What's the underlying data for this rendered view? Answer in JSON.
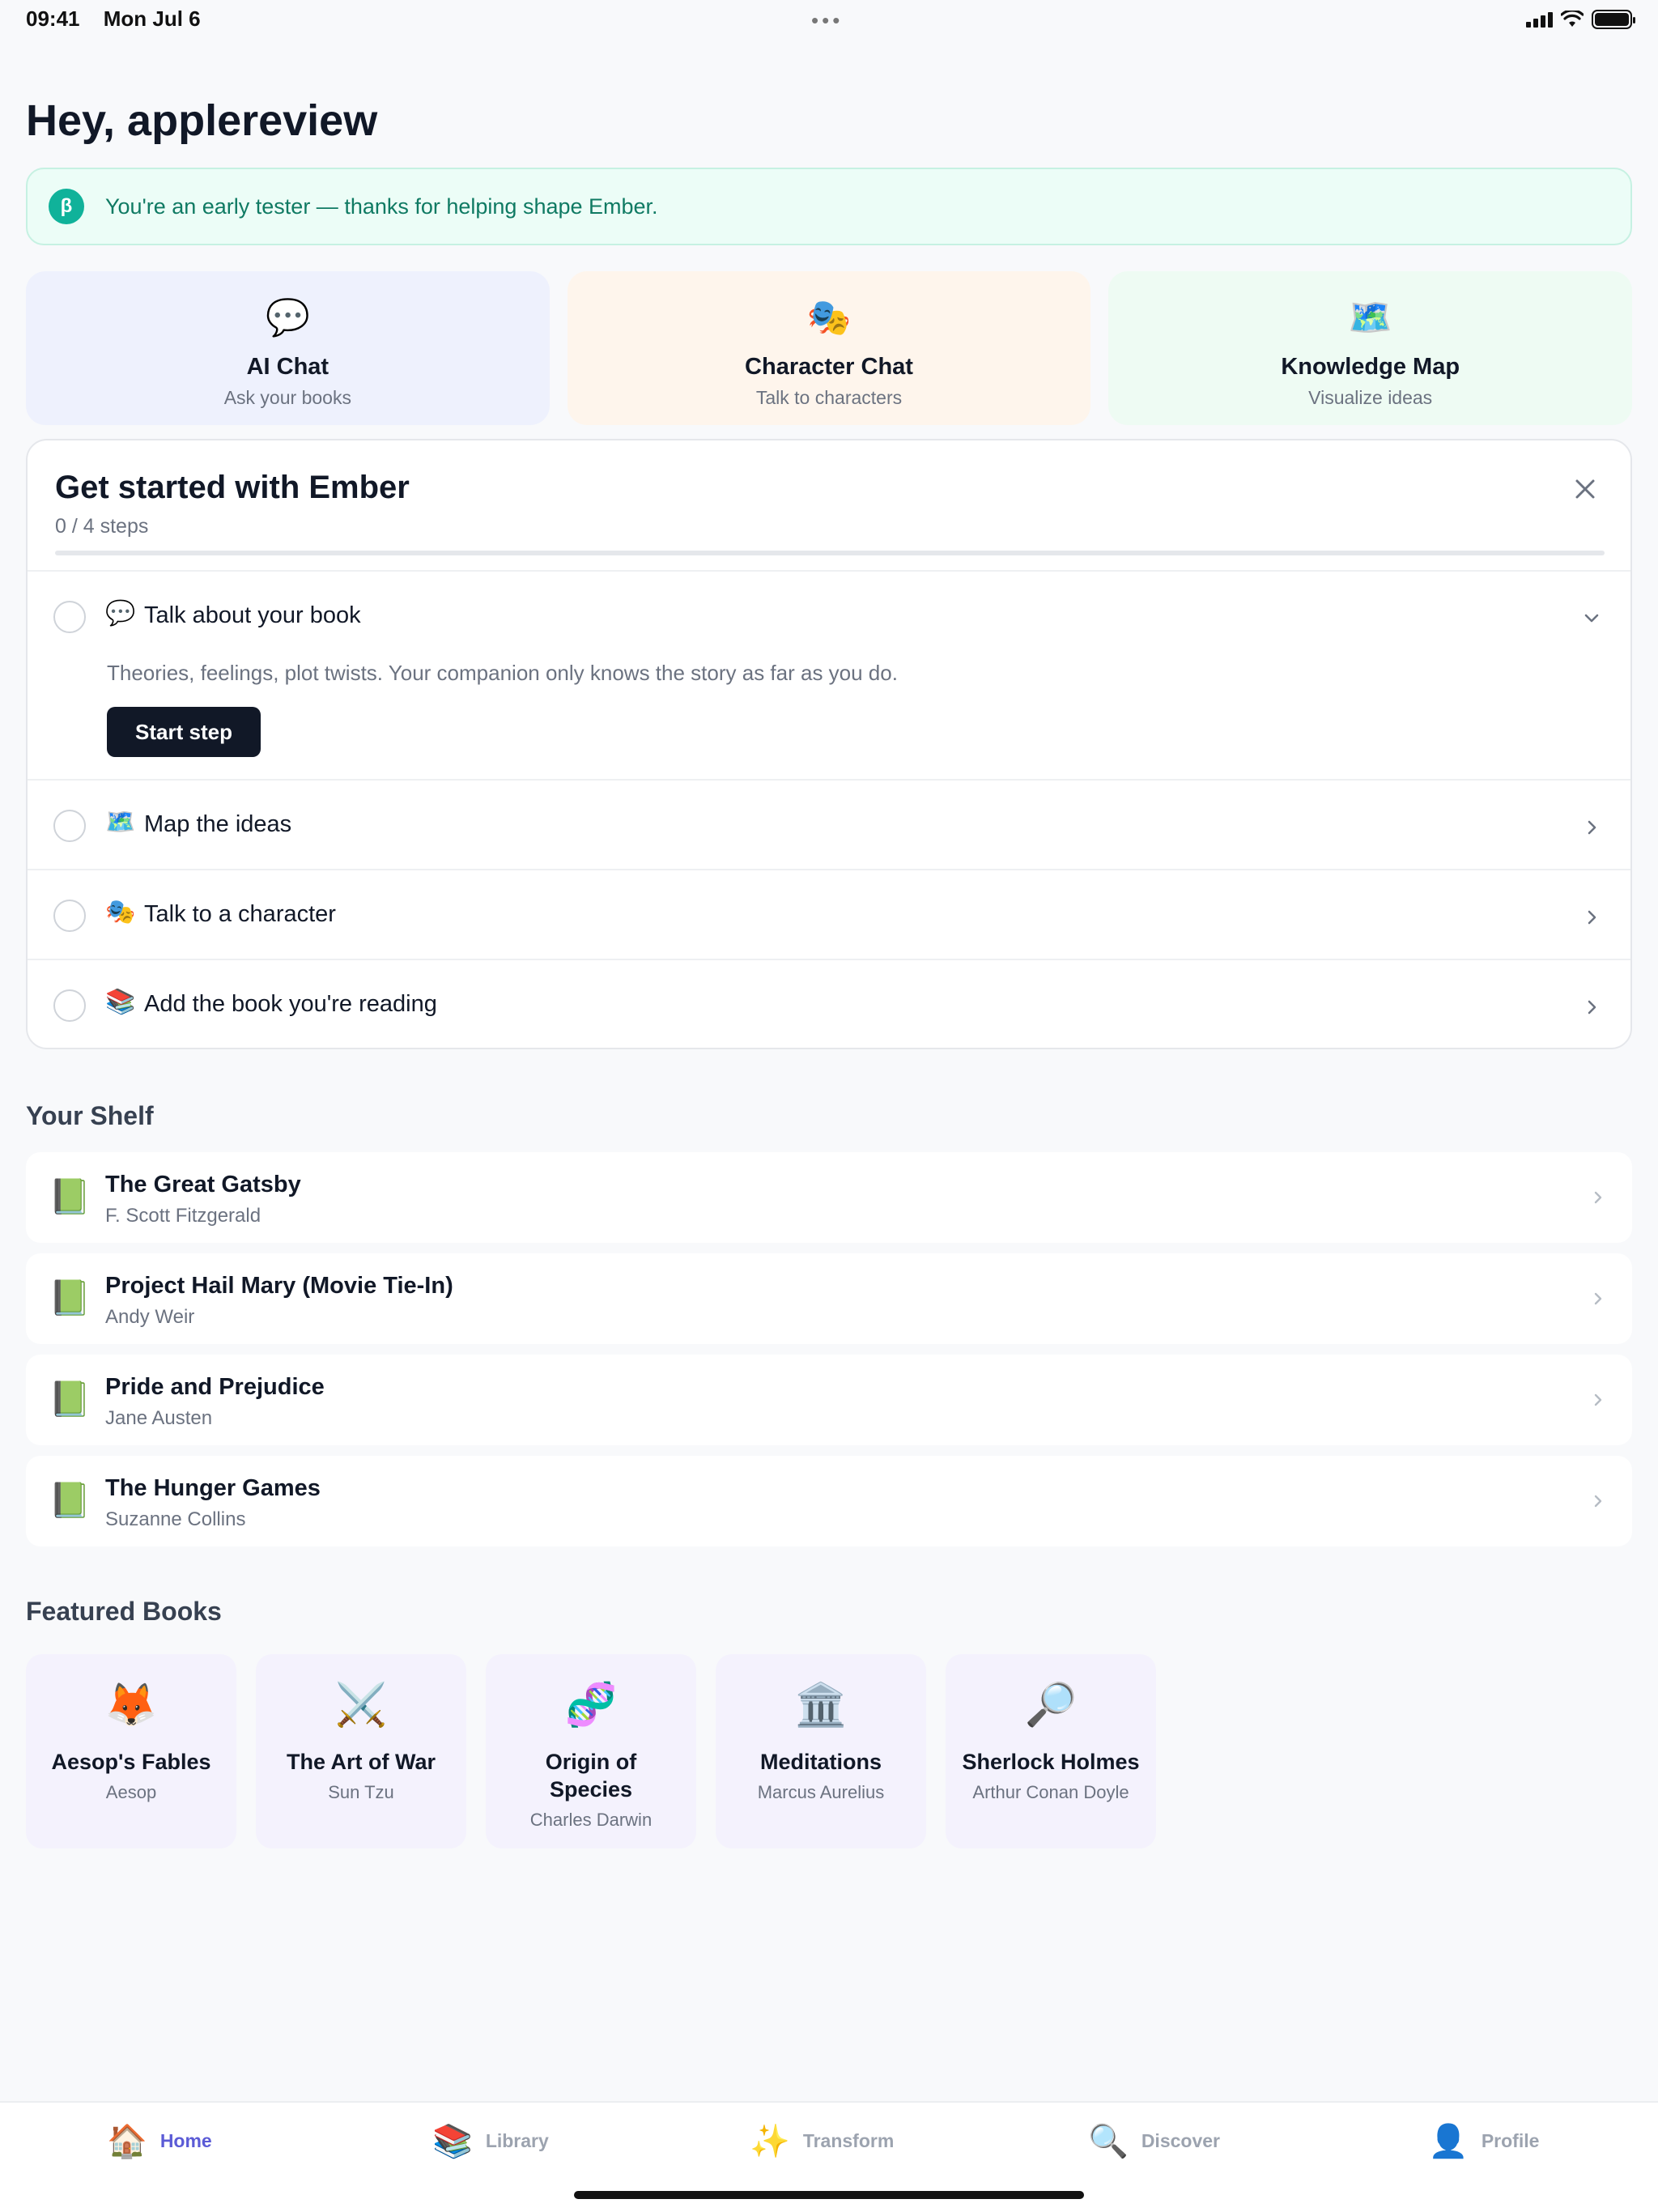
{
  "status_bar": {
    "time": "09:41",
    "date": "Mon Jul 6",
    "dots": "•••"
  },
  "greeting": "Hey, applereview",
  "beta": {
    "badge": "β",
    "text": "You're an early tester — thanks for helping shape Ember."
  },
  "quick_actions": [
    {
      "icon": "💬",
      "icon_name": "speech-bubble-icon",
      "title": "AI Chat",
      "subtitle": "Ask your books",
      "bg": "#eef1fd"
    },
    {
      "icon": "🎭",
      "icon_name": "theater-masks-icon",
      "title": "Character Chat",
      "subtitle": "Talk to characters",
      "bg": "#fef5ec"
    },
    {
      "icon": "🗺️",
      "icon_name": "world-map-icon",
      "title": "Knowledge Map",
      "subtitle": "Visualize ideas",
      "bg": "#eefbf3"
    }
  ],
  "onboarding": {
    "title": "Get started with Ember",
    "progress": "0 / 4 steps",
    "progress_fraction": 0,
    "steps": [
      {
        "icon": "💬",
        "label": "Talk about your book",
        "description": "Theories, feelings, plot twists. Your companion only knows the story as far as you do.",
        "button": "Start step",
        "expanded": true
      },
      {
        "icon": "🗺️",
        "label": "Map the ideas",
        "expanded": false
      },
      {
        "icon": "🎭",
        "label": "Talk to a character",
        "expanded": false
      },
      {
        "icon": "📚",
        "label": "Add the book you're reading",
        "expanded": false
      }
    ]
  },
  "shelf": {
    "title": "Your Shelf",
    "books": [
      {
        "icon": "📗",
        "title": "The Great Gatsby",
        "author": "F. Scott Fitzgerald"
      },
      {
        "icon": "📗",
        "title": "Project Hail Mary (Movie Tie-In)",
        "author": "Andy Weir"
      },
      {
        "icon": "📗",
        "title": "Pride and Prejudice",
        "author": "Jane Austen"
      },
      {
        "icon": "📗",
        "title": "The Hunger Games",
        "author": "Suzanne Collins"
      }
    ]
  },
  "featured": {
    "title": "Featured Books",
    "books": [
      {
        "icon": "🦊",
        "icon_name": "fox-icon",
        "title": "Aesop's Fables",
        "author": "Aesop"
      },
      {
        "icon": "⚔️",
        "icon_name": "crossed-swords-icon",
        "title": "The Art of War",
        "author": "Sun Tzu"
      },
      {
        "icon": "🧬",
        "icon_name": "dna-icon",
        "title": "Origin of Species",
        "author": "Charles Darwin"
      },
      {
        "icon": "🏛️",
        "icon_name": "classical-building-icon",
        "title": "Meditations",
        "author": "Marcus Aurelius"
      },
      {
        "icon": "🔎",
        "icon_name": "magnifier-icon",
        "title": "Sherlock Holmes",
        "author": "Arthur Conan Doyle"
      }
    ]
  },
  "tabs": [
    {
      "icon": "🏠",
      "label": "Home",
      "active": true
    },
    {
      "icon": "📚",
      "label": "Library",
      "active": false
    },
    {
      "icon": "✨",
      "label": "Transform",
      "active": false
    },
    {
      "icon": "🔍",
      "label": "Discover",
      "active": false
    },
    {
      "icon": "👤",
      "label": "Profile",
      "active": false
    }
  ],
  "colors": {
    "accent": "#5b5bd6",
    "beta_bg": "#ecfdf7",
    "beta_text": "#0f7a63",
    "button_dark": "#111827",
    "featured_bg": "#f4f2fd"
  }
}
